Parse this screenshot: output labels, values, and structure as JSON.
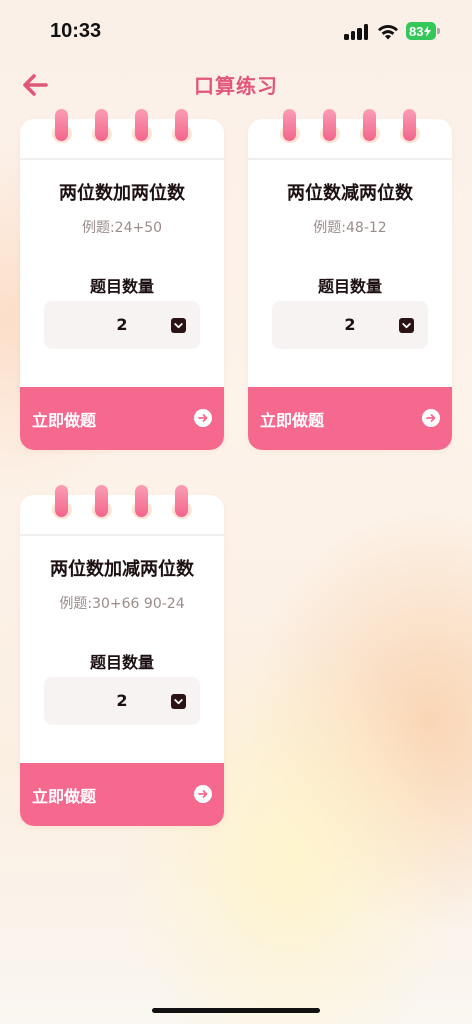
{
  "status_bar": {
    "time": "10:33",
    "battery": "83"
  },
  "header": {
    "title": "口算练习",
    "back_icon": "arrow-left-icon"
  },
  "colors": {
    "accent": "#f5698f",
    "title": "#e2567a",
    "text": "#1d1012",
    "muted": "#9b8c8a"
  },
  "cards": [
    {
      "title": "两位数加两位数",
      "example": "例题:24+50",
      "qty_label": "题目数量",
      "qty_value": "2",
      "start_label": "立即做题"
    },
    {
      "title": "两位数减两位数",
      "example": "例题:48-12",
      "qty_label": "题目数量",
      "qty_value": "2",
      "start_label": "立即做题"
    },
    {
      "title": "两位数加减两位数",
      "example": "例题:30+66 90-24",
      "qty_label": "题目数量",
      "qty_value": "2",
      "start_label": "立即做题"
    }
  ]
}
